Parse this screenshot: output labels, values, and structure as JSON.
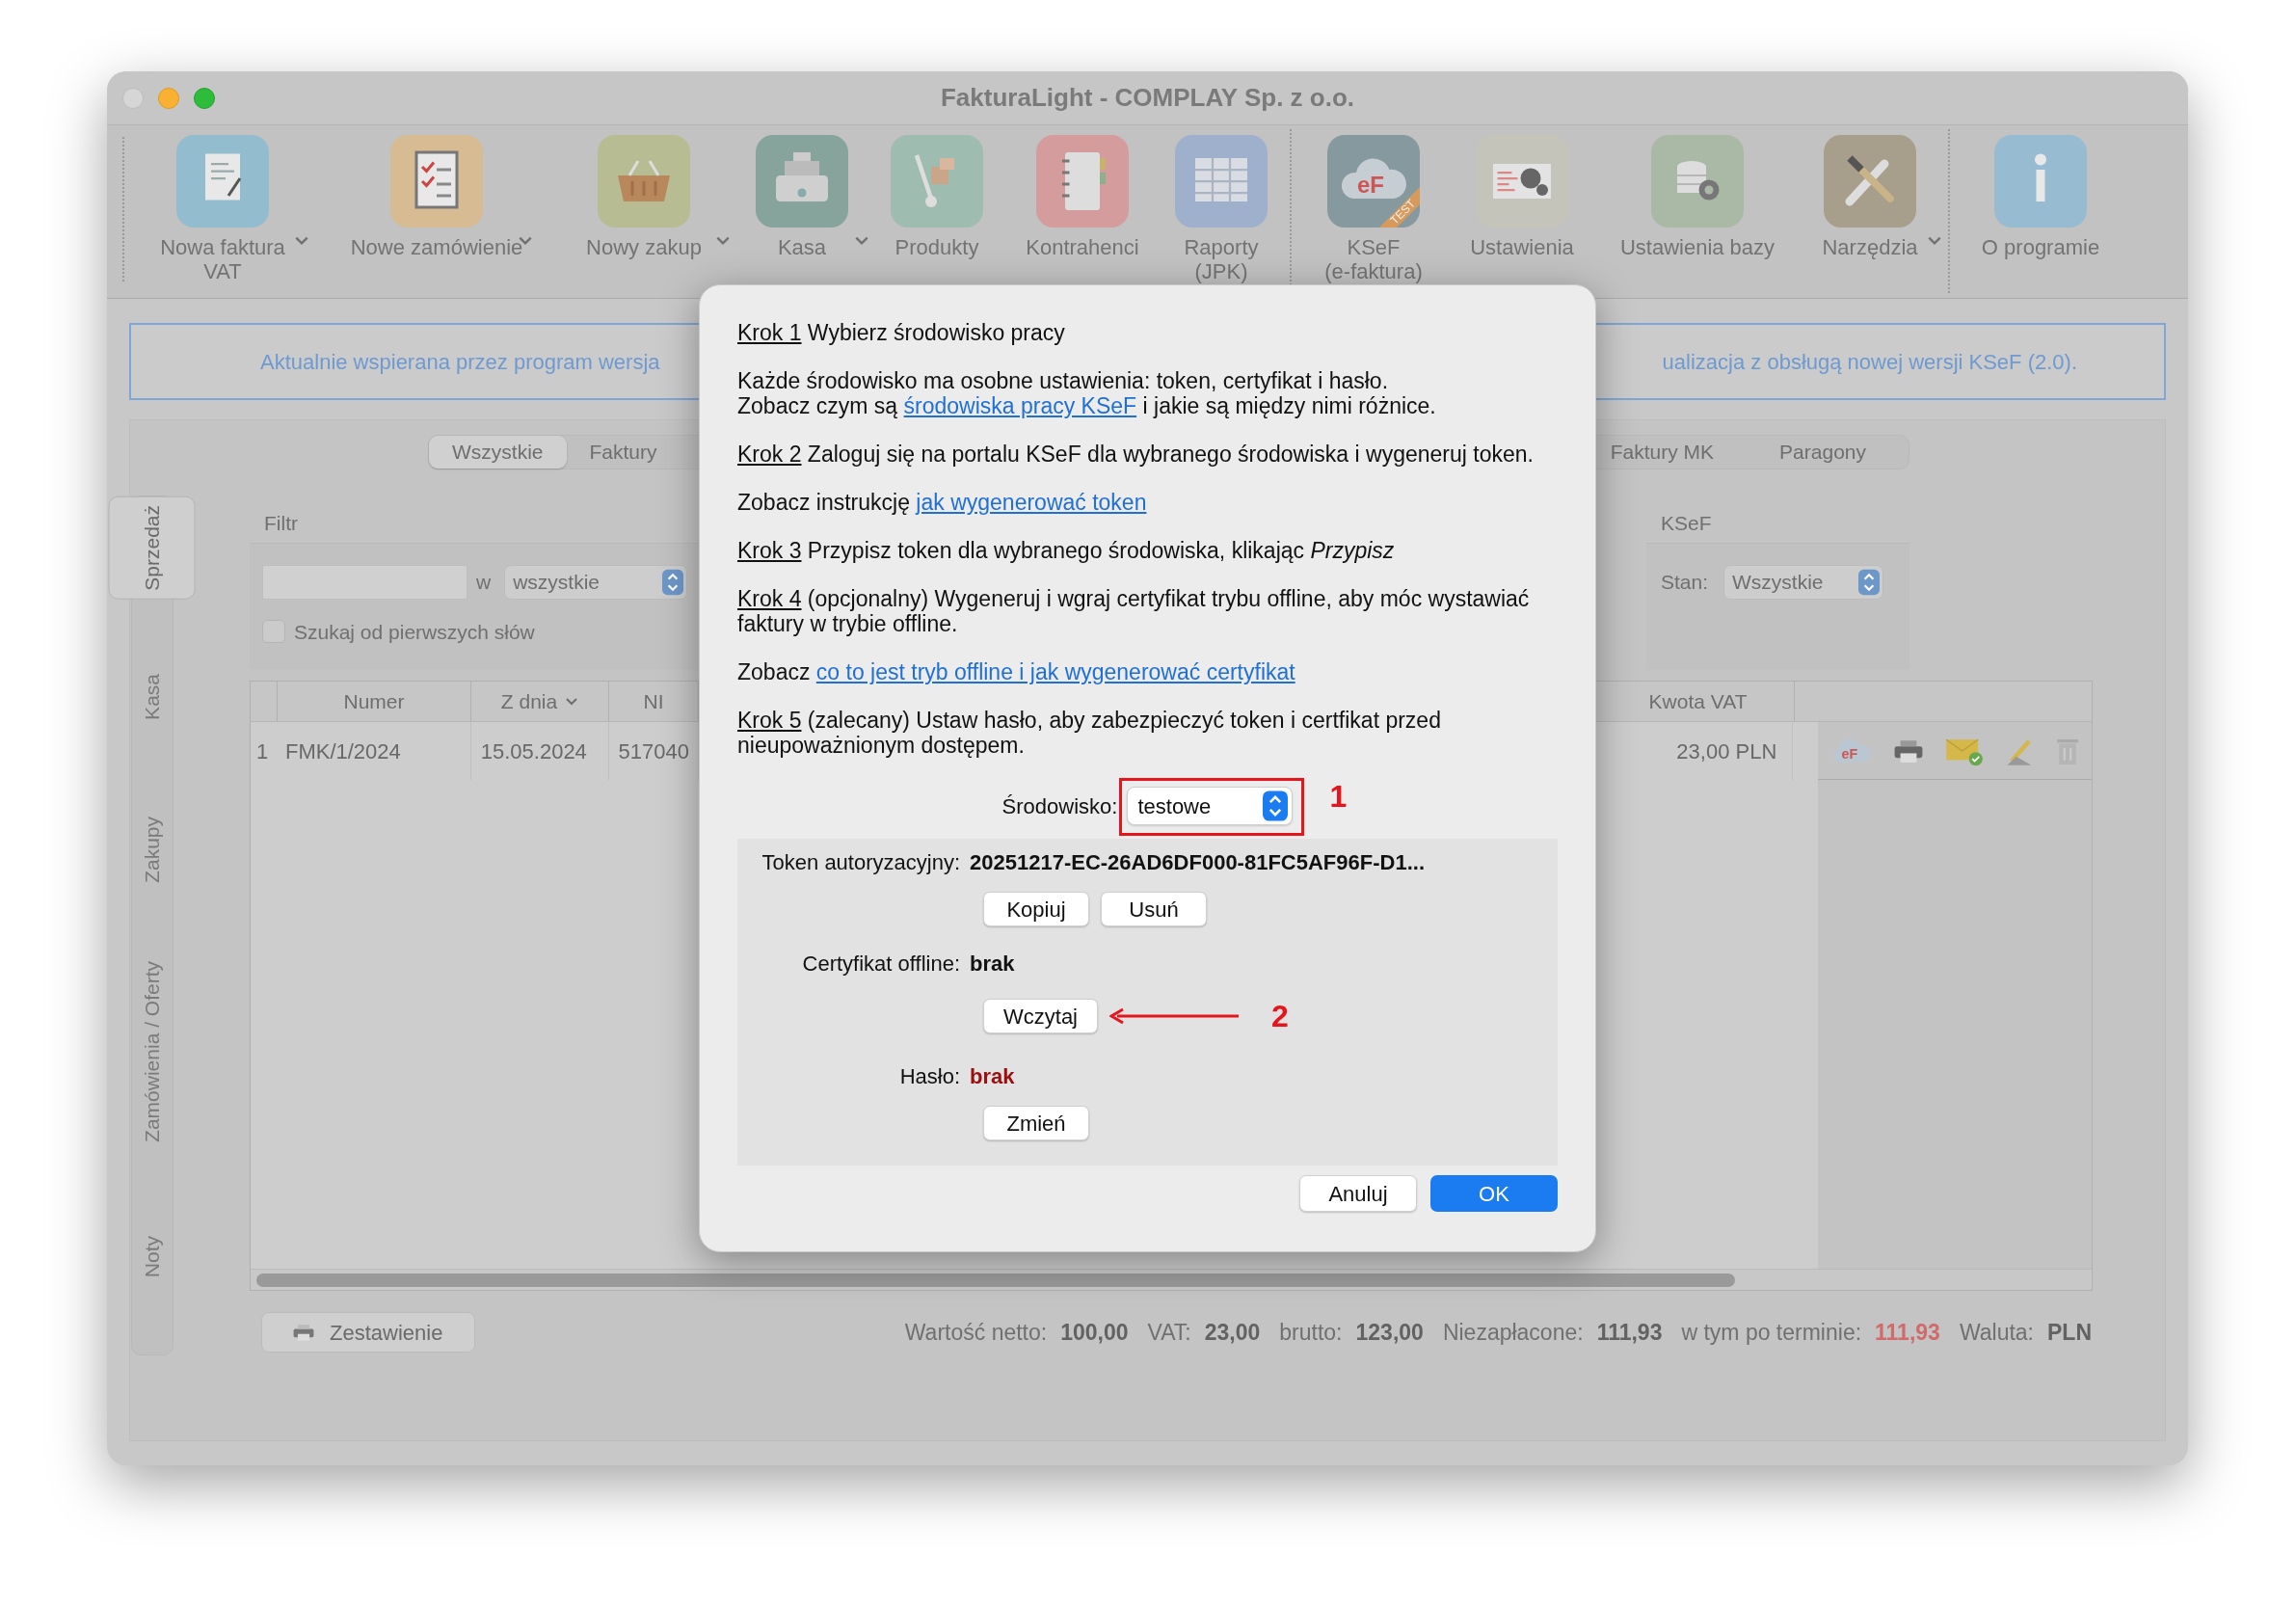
{
  "window": {
    "title": "FakturaLight - COMPLAY Sp. z o.o."
  },
  "toolbar": {
    "groups": [
      [
        {
          "label": "Nowa faktura\nVAT",
          "has_menu": true
        },
        {
          "label": "Nowe zamówienie",
          "has_menu": true
        },
        {
          "label": "Nowy zakup",
          "has_menu": true
        },
        {
          "label": "Kasa",
          "has_menu": true
        },
        {
          "label": "Produkty",
          "has_menu": false
        },
        {
          "label": "Kontrahenci",
          "has_menu": false
        },
        {
          "label": "Raporty\n(JPK)",
          "has_menu": false
        }
      ],
      [
        {
          "label": "KSeF\n(e-faktura)",
          "has_menu": false,
          "icon_label": "eF",
          "icon_badge": "TEST"
        },
        {
          "label": "Ustawienia",
          "has_menu": false
        },
        {
          "label": "Ustawienia bazy",
          "has_menu": false
        },
        {
          "label": "Narzędzia",
          "has_menu": true
        }
      ],
      [
        {
          "label": "O programie",
          "has_menu": false
        }
      ]
    ]
  },
  "banner": {
    "text_left": "Aktualnie wspierana przez program wersja",
    "text_right": "ualizacja z obsługą nowej wersji KSeF (2.0)."
  },
  "side_tabs": [
    {
      "label": "Sprzedaż",
      "selected": true
    },
    {
      "label": "Kasa",
      "selected": false
    },
    {
      "label": "Zakupy",
      "selected": false
    },
    {
      "label": "Zamówienia / Oferty",
      "selected": false
    },
    {
      "label": "Noty",
      "selected": false
    }
  ],
  "tabs": [
    {
      "label": "Wszystkie",
      "selected": true
    },
    {
      "label": "Faktury",
      "selected": false
    },
    {
      "label": "Faktury MK",
      "selected": false
    },
    {
      "label": "Paragony",
      "selected": false
    }
  ],
  "filter": {
    "title": "Filtr",
    "scope_label": "w",
    "scope": "wszystkie",
    "search_from_start": {
      "label": "Szukaj od pierwszych słów",
      "checked": false
    }
  },
  "ksef_filter": {
    "title": "KSeF",
    "state_label": "Stan:",
    "state": "Wszystkie"
  },
  "table": {
    "columns": [
      {
        "label": "Numer",
        "sorted": false
      },
      {
        "label": "Z dnia",
        "sorted": true
      },
      {
        "label": "NI",
        "sorted": false
      },
      {
        "label": "Kwota VAT",
        "sorted": false
      }
    ],
    "rows": [
      {
        "number": "1",
        "cells": [
          "FMK/1/2024",
          "15.05.2024",
          "517040",
          "23,00 PLN"
        ],
        "ksef_icon_label": "eF"
      }
    ]
  },
  "report_button": "Zestawienie",
  "summary": [
    {
      "label": "Wartość netto:",
      "value": "100,00",
      "overdue": false
    },
    {
      "label": "VAT:",
      "value": "23,00",
      "overdue": false
    },
    {
      "label": "brutto:",
      "value": "123,00",
      "overdue": false
    },
    {
      "label": "Niezapłacone:",
      "value": "111,93",
      "overdue": false
    },
    {
      "label": "w tym po terminie:",
      "value": "111,93",
      "overdue": true
    },
    {
      "label": "Waluta:",
      "value": "PLN",
      "overdue": false
    }
  ],
  "dialog": {
    "paragraphs": [
      {
        "lines": [
          [
            {
              "kind": "step",
              "text": "Krok 1"
            },
            {
              "kind": "text",
              "text": " Wybierz środowisko pracy"
            }
          ]
        ]
      },
      {
        "lines": [
          [
            {
              "kind": "text",
              "text": "Każde środowisko ma osobne ustawienia: token, certyfikat i hasło."
            }
          ],
          [
            {
              "kind": "text",
              "text": "Zobacz czym są "
            },
            {
              "kind": "link",
              "text": "środowiska pracy KSeF"
            },
            {
              "kind": "text",
              "text": " i jakie są między nimi różnice."
            }
          ]
        ]
      },
      {
        "lines": [
          [
            {
              "kind": "step",
              "text": "Krok 2"
            },
            {
              "kind": "text",
              "text": " Zaloguj się na portalu KSeF dla wybranego środowiska i wygeneruj token."
            }
          ]
        ]
      },
      {
        "lines": [
          [
            {
              "kind": "text",
              "text": "Zobacz instrukcję "
            },
            {
              "kind": "link",
              "text": "jak wygenerować token"
            }
          ]
        ]
      },
      {
        "lines": [
          [
            {
              "kind": "step",
              "text": "Krok 3"
            },
            {
              "kind": "text",
              "text": " Przypisz token dla wybranego środowiska, klikając *Przypisz*"
            }
          ]
        ]
      },
      {
        "lines": [
          [
            {
              "kind": "step",
              "text": "Krok 4"
            },
            {
              "kind": "text",
              "text": " (opcjonalny) Wygeneruj i wgraj certyfikat trybu offline, aby móc wystawiać faktury w trybie offline."
            }
          ]
        ]
      },
      {
        "lines": [
          [
            {
              "kind": "text",
              "text": "Zobacz "
            },
            {
              "kind": "link",
              "text": "co to jest tryb offline i jak wygenerować certyfikat"
            }
          ]
        ]
      },
      {
        "lines": [
          [
            {
              "kind": "step",
              "text": "Krok 5"
            },
            {
              "kind": "text",
              "text": " (zalecany) Ustaw hasło, aby zabezpieczyć token i certfikat przed nieupoważnionym dostępem."
            }
          ]
        ]
      }
    ],
    "environment": {
      "label": "Środowisko:",
      "value": "testowe"
    },
    "settings": [
      {
        "label": "Token autoryzacyjny:",
        "value": "20251217-EC-26AD6DF000-81FC5AF96F-D1...",
        "warning": false,
        "buttons": [
          "Kopiuj",
          "Usuń"
        ]
      },
      {
        "label": "Certyfikat offline:",
        "value": "brak",
        "warning": false,
        "buttons": [
          "Wczytaj"
        ]
      },
      {
        "label": "Hasło:",
        "value": "brak",
        "warning": true,
        "buttons": [
          "Zmień"
        ]
      }
    ],
    "buttons": [
      {
        "label": "Anuluj",
        "default": false
      },
      {
        "label": "OK",
        "default": true
      }
    ],
    "annotations": [
      {
        "kind": "box",
        "label": "1"
      },
      {
        "kind": "arrow",
        "label": "2"
      }
    ]
  }
}
